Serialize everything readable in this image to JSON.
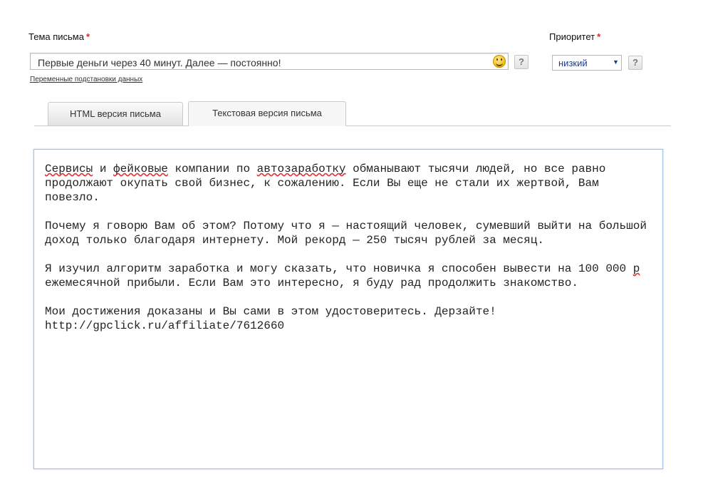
{
  "subject": {
    "label": "Тема письма",
    "required_mark": "*",
    "value": "Первые деньги через 40 минут. Далее — постоянно!",
    "help": "?",
    "emoji_icon": "smiley-icon",
    "variables_link": "Переменные подстановки данных"
  },
  "priority": {
    "label": "Приоритет",
    "required_mark": "*",
    "selected": "низкий",
    "arrow": "▼",
    "help": "?"
  },
  "tabs": [
    {
      "label": "HTML версия письма",
      "active": false
    },
    {
      "label": "Текстовая версия письма",
      "active": true
    }
  ],
  "body": {
    "p1": {
      "a": "Сервисы",
      "b": " и ",
      "c": "фейковые",
      "d": " компании по ",
      "e": "автозаработку",
      "f": " обманывают тысячи людей, но все равно продолжают окупать свой бизнес, к сожалению. Если Вы еще не стали их жертвой, Вам повезло."
    },
    "p2": "Почему я говорю Вам об этом? Потому что я — настоящий человек, сумевший выйти на большой доход только благодаря интернету. Мой рекорд — 250 тысяч рублей за месяц.",
    "p3": {
      "a": "Я изучил алгоритм заработка и могу сказать, что новичка я способен вывести на 100 000 ",
      "b": "р",
      "c": " ежемесячной прибыли. Если Вам это интересно, я буду рад продолжить знакомство."
    },
    "p4": "Мои достижения доказаны и Вы сами в этом удостоверитесь. Дерзайте!\nhttp://gpclick.ru/affiliate/7612660"
  },
  "colors": {
    "required": "#d9262b",
    "select_text": "#1a3d8f",
    "editor_border": "#9cc4ea",
    "spellcheck": "#e23030"
  }
}
